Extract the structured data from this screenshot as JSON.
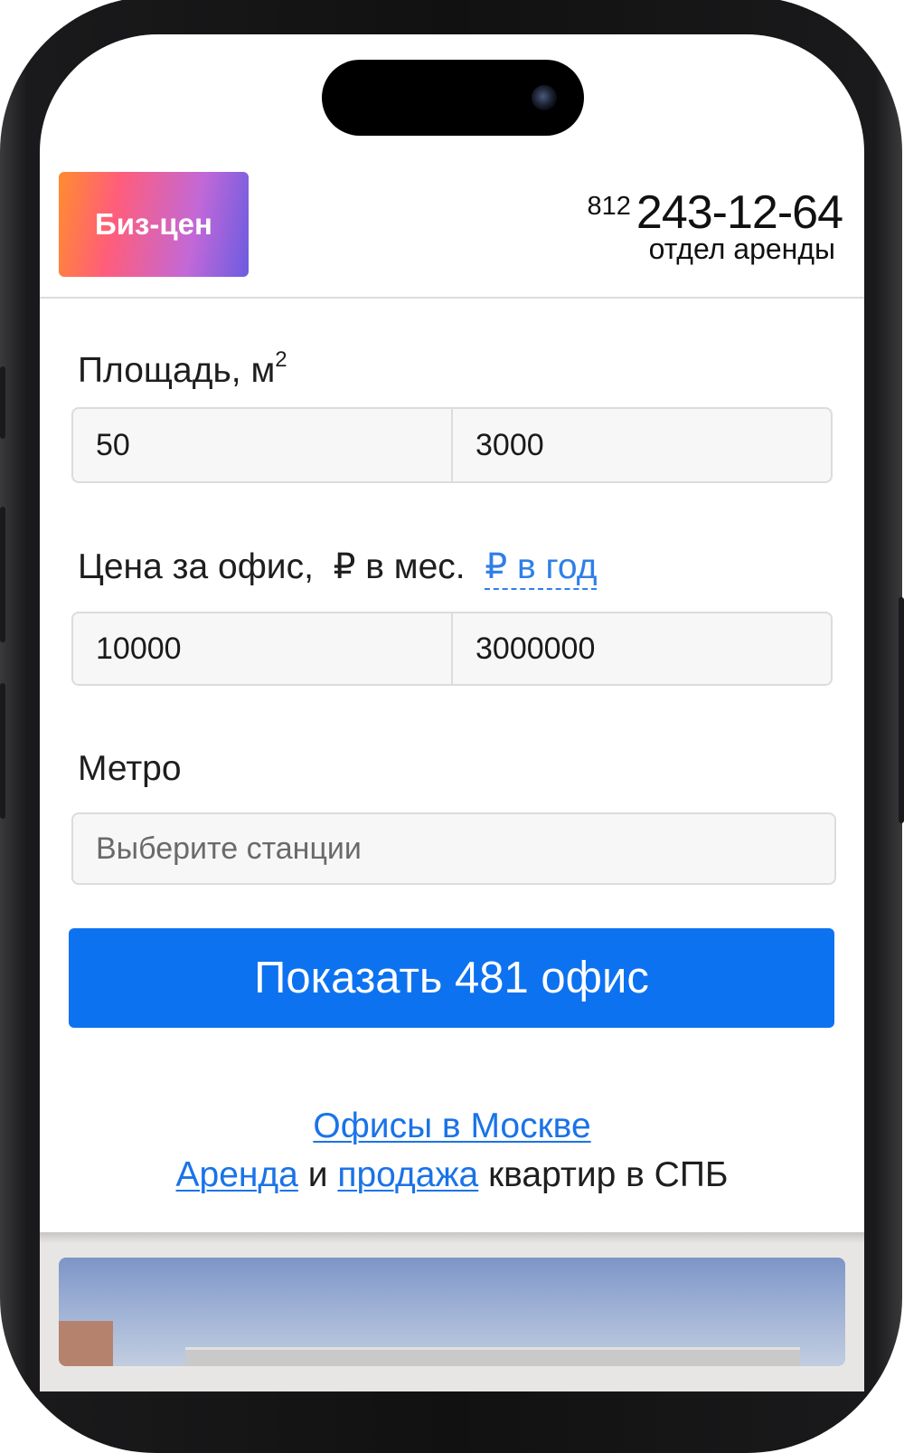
{
  "header": {
    "logo_text": "Биз-цен",
    "phone_code": "812",
    "phone_number": "243-12-64",
    "phone_caption": "отдел аренды"
  },
  "area": {
    "label": "Площадь, м",
    "label_sup": "2",
    "from_value": "50",
    "to_value": "3000"
  },
  "price": {
    "label": "Цена за офис,",
    "per_month": "₽ в мес.",
    "per_year": "₽ в год",
    "from_value": "10000",
    "to_value": "3000000"
  },
  "metro": {
    "label": "Метро",
    "placeholder": "Выберите станции"
  },
  "show_button": {
    "label": "Показать 481 офис"
  },
  "links": {
    "moscow": "Офисы в Москве",
    "rent": "Аренда",
    "and": "и",
    "sale": "продажа",
    "tail": "квартир в СПБ"
  },
  "colors": {
    "accent": "#0d72f0",
    "link": "#1a73e8"
  }
}
